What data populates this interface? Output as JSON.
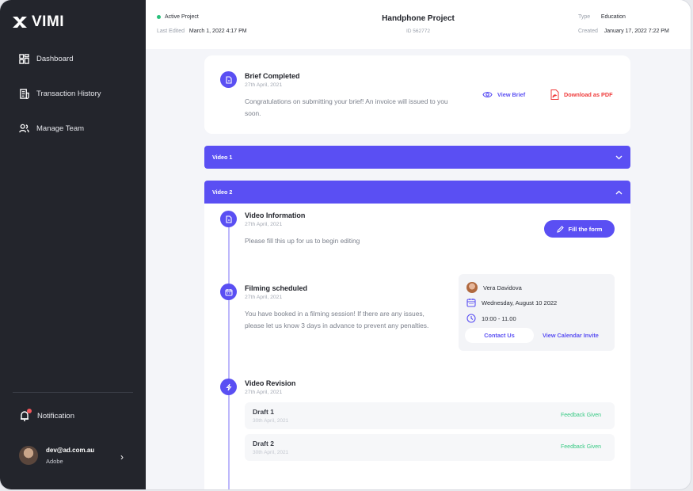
{
  "app": {
    "logo_text": "VIMI"
  },
  "sidebar": {
    "items": [
      {
        "label": "Dashboard",
        "icon": "dashboard-icon"
      },
      {
        "label": "Transaction History",
        "icon": "receipt-icon"
      },
      {
        "label": "Manage Team",
        "icon": "team-icon"
      }
    ],
    "notification_label": "Notification",
    "user": {
      "email": "dev@ad.com.au",
      "org": "Adobe"
    }
  },
  "header": {
    "status": "Active Project",
    "last_edited_label": "Last Edited",
    "last_edited_value": "March 1, 2022 4:17 PM",
    "title": "Handphone Project",
    "id": "ID 562772",
    "type_label": "Type",
    "type_value": "Education",
    "created_label": "Created",
    "created_value": "January 17, 2022 7:22 PM"
  },
  "brief": {
    "title": "Brief Completed",
    "date": "27th April, 2021",
    "desc": "Congratulations on submitting your brief! An invoice will issued to you soon.",
    "view_label": "View Brief",
    "download_label": "Download as PDF"
  },
  "accordions": [
    {
      "label": "Video 1",
      "open": false
    },
    {
      "label": "Video 2",
      "open": true
    }
  ],
  "video2": {
    "info": {
      "title": "Video Information",
      "date": "27th April, 2021",
      "desc": "Please fill this up for us to begin editing",
      "button_label": "Fill the form"
    },
    "filming": {
      "title": "Filming scheduled",
      "date": "27th April, 2021",
      "desc": "You have booked in a filming session! If there are any issues, please let us know 3 days in advance to prevent any penalties.",
      "person": "Vera Davidova",
      "day": "Wednesday, August 10 2022",
      "time": "10:00 - 11.00",
      "contact_label": "Contact Us",
      "calendar_label": "View Calendar Invite"
    },
    "revision": {
      "title": "Video Revision",
      "date": "27th April, 2021",
      "drafts": [
        {
          "name": "Draft 1",
          "date": "30th April, 2021",
          "status": "Feedback Given"
        },
        {
          "name": "Draft 2",
          "date": "30th April, 2021",
          "status": "Feedback Given"
        }
      ]
    }
  },
  "colors": {
    "accent": "#5a4ff3",
    "sidebar": "#23252c",
    "success": "#37c983",
    "danger": "#ef3b3b"
  }
}
